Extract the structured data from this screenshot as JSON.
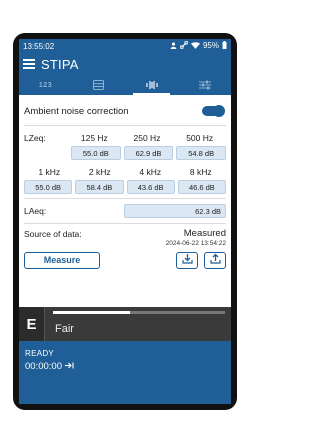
{
  "statusbar": {
    "time": "13:55:02",
    "battery": "95%"
  },
  "appbar": {
    "title": "STIPA"
  },
  "tabs": [
    {
      "label": "123",
      "icon": "numbers-icon"
    },
    {
      "label": "",
      "icon": "table-icon"
    },
    {
      "label": "",
      "icon": "waveform-icon"
    },
    {
      "label": "",
      "icon": "sliders-icon"
    }
  ],
  "ambient": {
    "label": "Ambient noise correction",
    "enabled": true
  },
  "lzeq": {
    "label": "LZeq:",
    "row1": [
      {
        "freq": "125 Hz",
        "value": "55.0 dB"
      },
      {
        "freq": "250 Hz",
        "value": "62.9 dB"
      },
      {
        "freq": "500 Hz",
        "value": "54.8 dB"
      }
    ],
    "row2": [
      {
        "freq": "1 kHz",
        "value": "55.0 dB"
      },
      {
        "freq": "2 kHz",
        "value": "58.4 dB"
      },
      {
        "freq": "4 kHz",
        "value": "43.6 dB"
      },
      {
        "freq": "8 kHz",
        "value": "46.6 dB"
      }
    ]
  },
  "laeq": {
    "label": "LAeq:",
    "value": "62.3 dB"
  },
  "source": {
    "label": "Source of data:",
    "value": "Measured",
    "date": "2024-06-22 13:54:22"
  },
  "actions": {
    "measure_label": "Measure"
  },
  "rating": {
    "letter": "E",
    "text": "Fair",
    "level": 0.45
  },
  "bottom": {
    "status": "READY",
    "time": "00:00:00"
  },
  "colors": {
    "primary": "#1f5e96",
    "value_bg": "#dbe8f4",
    "rating_bg": "#3a3a3a"
  }
}
